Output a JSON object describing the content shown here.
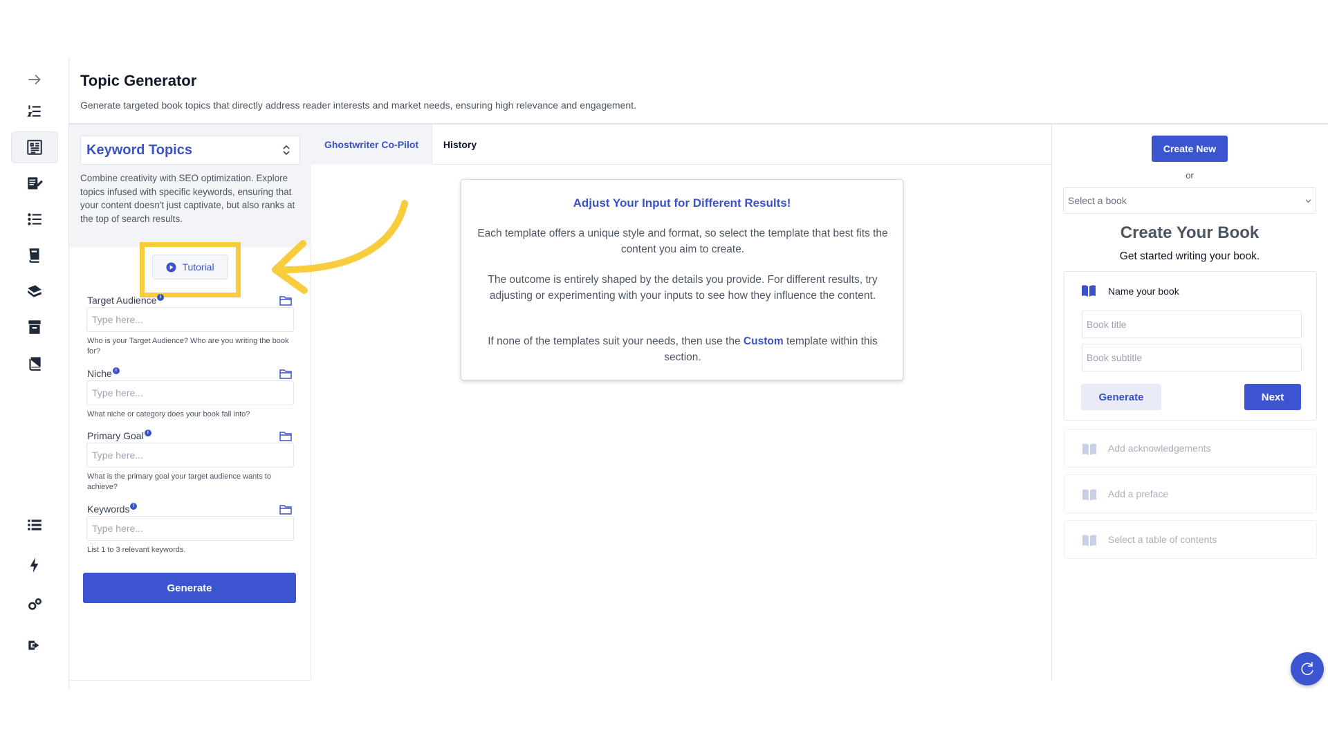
{
  "page": {
    "title": "Topic Generator",
    "subtitle": "Generate targeted book topics that directly address reader interests and market needs, ensuring high relevance and engagement."
  },
  "sidebar": {
    "icons": [
      "arrow-right-icon",
      "numbered-list-icon",
      "newspaper-icon",
      "edit-document-icon",
      "bullet-list-icon",
      "book-stack-icon",
      "books-icon",
      "archive-icon",
      "book-icon",
      "list-icon",
      "lightning-icon",
      "gears-icon",
      "logout-icon"
    ],
    "active_index": 2
  },
  "left_panel": {
    "template_select": "Keyword Topics",
    "description": "Combine creativity with SEO optimization. Explore topics infused with specific keywords, ensuring that your content doesn't just captivate, but also ranks at the top of search results.",
    "tutorial_label": "Tutorial",
    "fields": [
      {
        "label": "Target Audience",
        "placeholder": "Type here...",
        "value": "",
        "help": "Who is your Target Audience? Who are you writing the book for?"
      },
      {
        "label": "Niche",
        "placeholder": "Type here...",
        "value": "",
        "help": "What niche or category does your book fall into?"
      },
      {
        "label": "Primary Goal",
        "placeholder": "Type here...",
        "value": "",
        "help": "What is the primary goal your target audience wants to achieve?"
      },
      {
        "label": "Keywords",
        "placeholder": "Type here...",
        "value": "",
        "help": "List 1 to 3 relevant keywords."
      }
    ],
    "generate_label": "Generate"
  },
  "center": {
    "tabs": [
      "Ghostwriter Co-Pilot",
      "History"
    ],
    "active_tab": 0,
    "card": {
      "title": "Adjust Your Input for Different Results!",
      "p1": "Each template offers a unique style and format, so select the template that best fits the content you aim to create.",
      "p2": "The outcome is entirely shaped by the details you provide. For different results, try adjusting or experimenting with your inputs to see how they influence the content.",
      "p3_before": "If none of the templates suit your needs, then use the",
      "p3_link": "Custom",
      "p3_after": "template within this section."
    }
  },
  "right_panel": {
    "create_new_label": "Create New",
    "or_label": "or",
    "book_select": "Select a book",
    "heading": "Create Your Book",
    "subheading": "Get started writing your book.",
    "step_name": {
      "label": "Name your book",
      "title_placeholder": "Book title",
      "subtitle_placeholder": "Book subtitle",
      "generate_label": "Generate",
      "next_label": "Next"
    },
    "steps": [
      "Add acknowledgements",
      "Add a preface",
      "Select a table of contents"
    ]
  },
  "colors": {
    "accent": "#3b55d1",
    "highlight": "#f7cd3d"
  }
}
